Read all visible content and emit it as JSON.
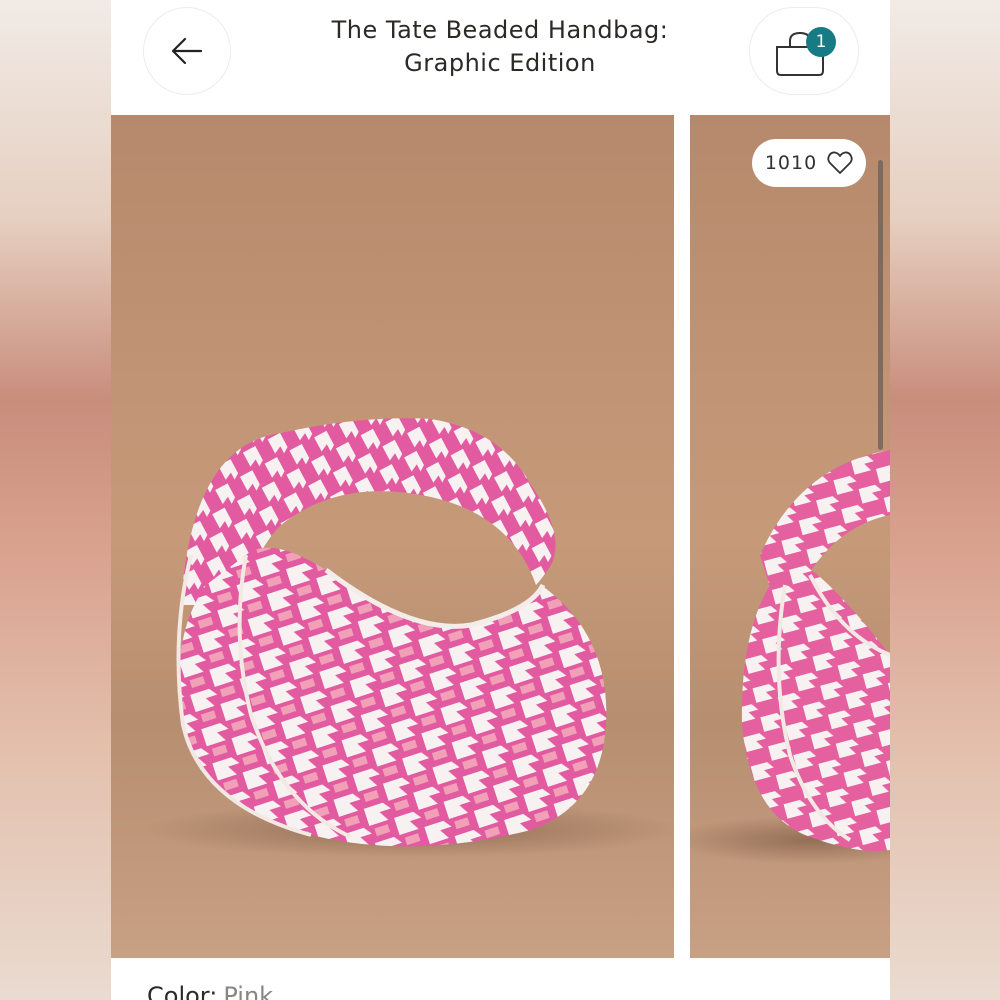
{
  "header": {
    "title": "The Tate Beaded Handbag: Graphic Edition",
    "title_line1": "The Tate Beaded Handbag:",
    "title_line2": "Graphic Edition",
    "cart_count": "1"
  },
  "gallery": {
    "like_count": "1010",
    "slides": [
      {
        "subject": "pink and white houndstooth beaded handbag"
      },
      {
        "subject": "pink and white houndstooth beaded handbag"
      }
    ]
  },
  "product": {
    "color_label": "Color:",
    "color_value": "Pink"
  },
  "colors": {
    "accent": "#177b86",
    "backdrop": "#c69a79",
    "bag_pink": "#e7569e",
    "bag_white": "#f5f0ee"
  },
  "icons": {
    "back": "arrow-left-icon",
    "cart": "shopping-bag-icon",
    "like": "heart-icon"
  }
}
